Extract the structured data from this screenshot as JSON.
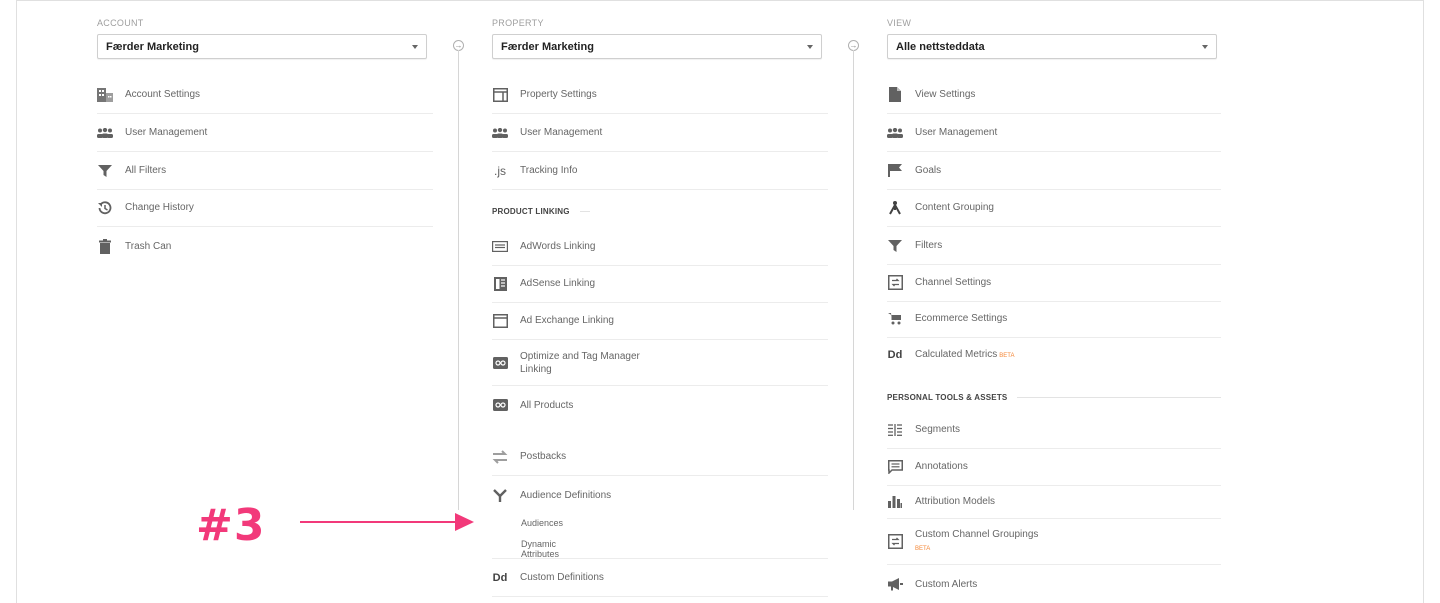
{
  "account": {
    "label": "ACCOUNT",
    "selected": "Færder Marketing",
    "items": [
      {
        "label": "Account Settings",
        "icon": "building-icon"
      },
      {
        "label": "User Management",
        "icon": "users-icon"
      },
      {
        "label": "All Filters",
        "icon": "filter-icon"
      },
      {
        "label": "Change History",
        "icon": "history-icon"
      },
      {
        "label": "Trash Can",
        "icon": "trash-icon"
      }
    ]
  },
  "property": {
    "label": "PROPERTY",
    "selected": "Færder Marketing",
    "items": [
      {
        "label": "Property Settings",
        "icon": "property-icon"
      },
      {
        "label": "User Management",
        "icon": "users-icon"
      },
      {
        "label": "Tracking Info",
        "icon": "js-icon",
        "icon_text": ".js"
      }
    ],
    "product_linking_label": "PRODUCT LINKING",
    "linking": [
      {
        "label": "AdWords Linking",
        "icon": "adwords-icon"
      },
      {
        "label": "AdSense Linking",
        "icon": "adsense-icon"
      },
      {
        "label": "Ad Exchange Linking",
        "icon": "adexchange-icon"
      },
      {
        "label": "Optimize and Tag Manager Linking",
        "line1": "Optimize and Tag Manager",
        "line2": "Linking",
        "icon": "link-icon"
      },
      {
        "label": "All Products",
        "icon": "link-icon"
      }
    ],
    "postbacks": "Postbacks",
    "audience_definitions": "Audience Definitions",
    "audiences": "Audiences",
    "dynamic_attributes": "Dynamic Attributes",
    "custom_definitions": "Custom Definitions",
    "dd_icon_text": "Dd"
  },
  "view": {
    "label": "VIEW",
    "selected": "Alle nettsteddata",
    "items": [
      {
        "label": "View Settings",
        "icon": "document-icon"
      },
      {
        "label": "User Management",
        "icon": "users-icon"
      },
      {
        "label": "Goals",
        "icon": "flag-icon"
      },
      {
        "label": "Content Grouping",
        "icon": "content-grouping-icon"
      },
      {
        "label": "Filters",
        "icon": "filter-icon"
      },
      {
        "label": "Channel Settings",
        "icon": "channel-icon"
      },
      {
        "label": "Ecommerce Settings",
        "icon": "cart-icon"
      },
      {
        "label": "Calculated Metrics",
        "icon": "dd-icon",
        "icon_text": "Dd",
        "badge": "BETA"
      }
    ],
    "personal_label": "PERSONAL TOOLS & ASSETS",
    "personal": [
      {
        "label": "Segments",
        "icon": "segments-icon"
      },
      {
        "label": "Annotations",
        "icon": "annotations-icon"
      },
      {
        "label": "Attribution Models",
        "icon": "bar-chart-icon"
      },
      {
        "label": "Custom Channel Groupings",
        "icon": "channel-icon",
        "badge": "BETA"
      },
      {
        "label": "Custom Alerts",
        "icon": "megaphone-icon"
      }
    ]
  },
  "annotation": {
    "text": "#3",
    "color": "#f2397a"
  },
  "colors": {
    "accent_pink": "#f2397a",
    "beta_orange": "#f48636",
    "text_gray": "#666666"
  }
}
